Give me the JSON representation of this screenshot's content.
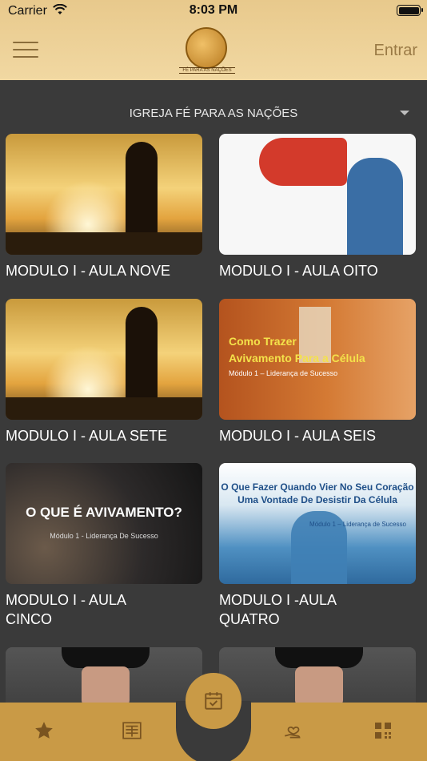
{
  "status_bar": {
    "carrier": "Carrier",
    "time": "8:03 PM",
    "wifi_icon": "wifi-icon",
    "battery_icon": "battery-icon"
  },
  "header": {
    "menu_icon": "hamburger-menu-icon",
    "logo_caption": "FÉ PARA AS NAÇÕES",
    "login_label": "Entrar"
  },
  "church_selector": {
    "selected": "IGREJA FÉ PARA AS NAÇÕES",
    "arrow_icon": "chevron-down-icon"
  },
  "lessons": [
    {
      "title": "MODULO I - AULA NOVE"
    },
    {
      "title": "MODULO I - AULA OITO"
    },
    {
      "title": "MODULO I - AULA SETE"
    },
    {
      "title": "MODULO I - AULA SEIS",
      "thumb_text": [
        "Como Trazer",
        "Avivamento Para a Célula",
        "Módulo 1 – Liderança de Sucesso"
      ]
    },
    {
      "title": "MODULO I - AULA CINCO",
      "thumb_text": [
        "O QUE É AVIVAMENTO?",
        "Módulo 1 - Liderança De Sucesso"
      ]
    },
    {
      "title": "MODULO I -AULA QUATRO",
      "thumb_text": [
        "O Que Fazer Quando Vier No Seu Coração Uma Vontade De Desistir Da Célula",
        "Módulo 1 – Liderança de Sucesso"
      ]
    }
  ],
  "tab_bar": {
    "favorites_icon": "star-icon",
    "news_icon": "newspaper-icon",
    "calendar_icon": "calendar-check-icon",
    "offering_icon": "heart-hand-icon",
    "qr_icon": "qr-code-icon"
  }
}
